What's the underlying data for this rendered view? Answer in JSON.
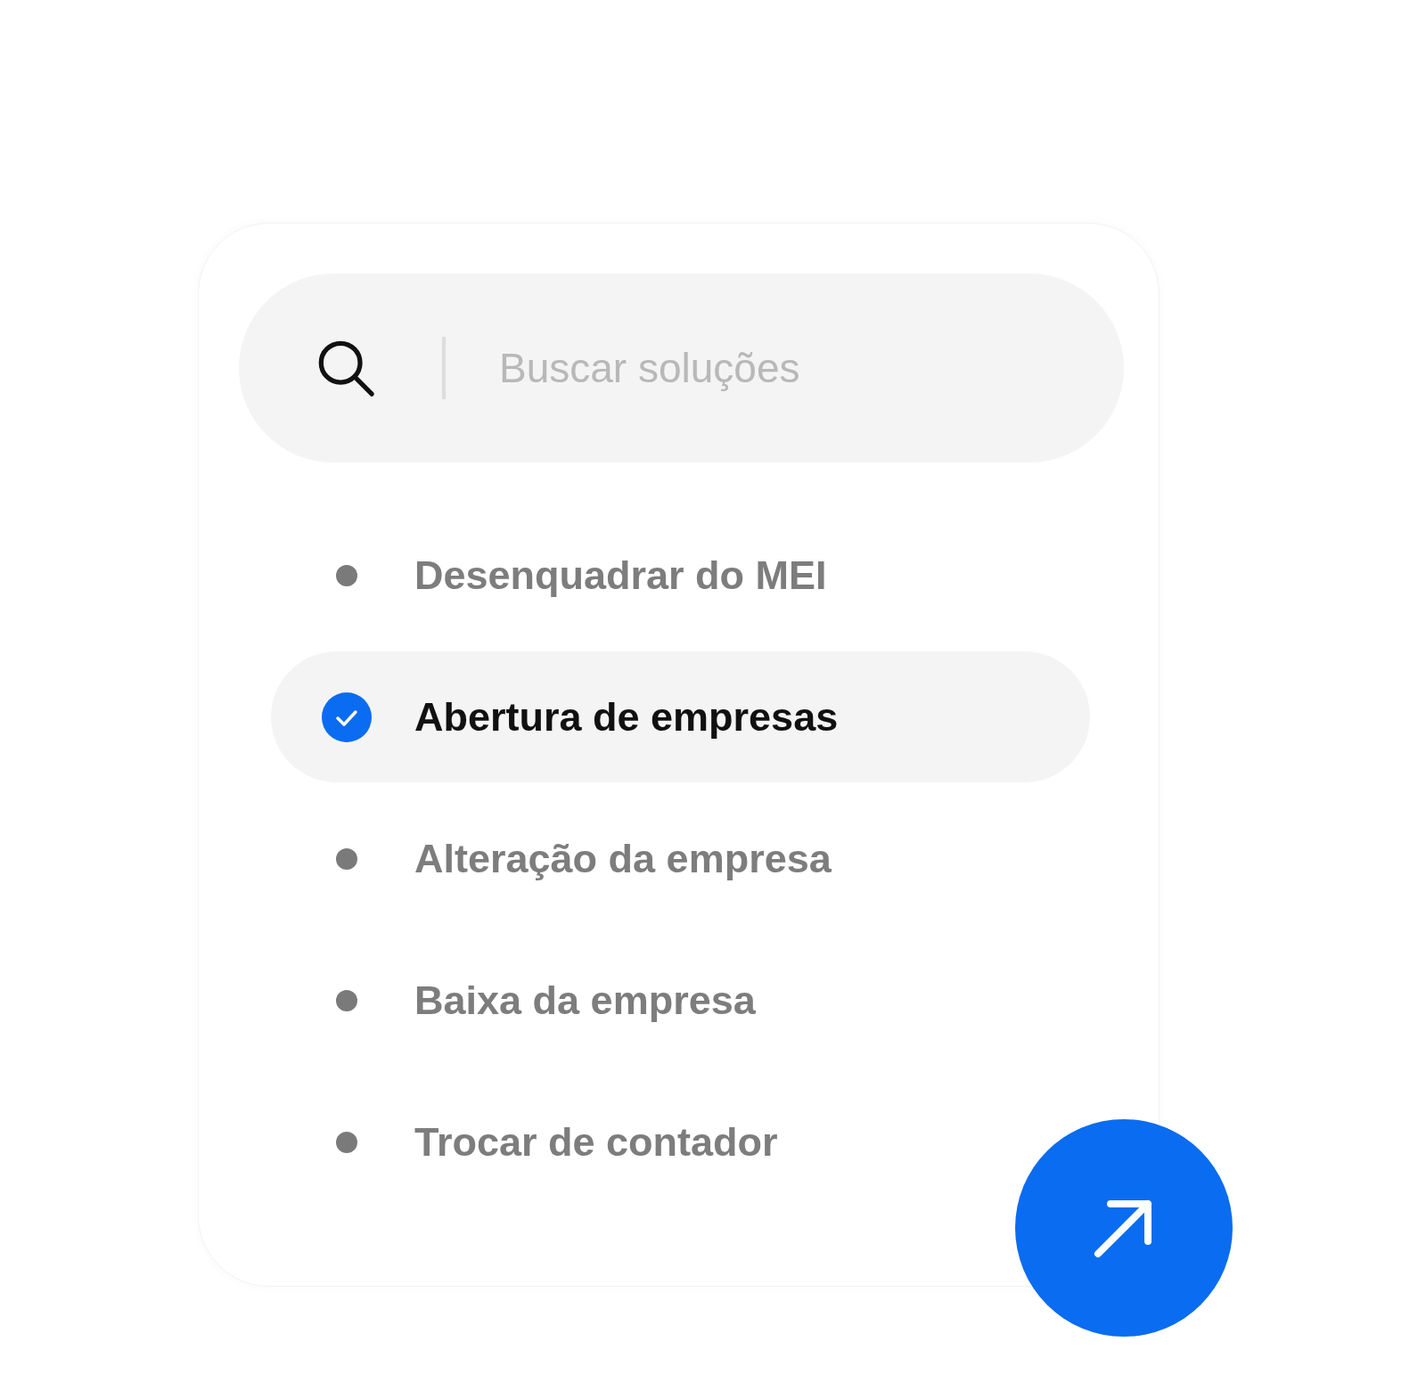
{
  "search": {
    "placeholder": "Buscar soluções"
  },
  "items": [
    {
      "label": "Desenquadrar do MEI",
      "selected": false
    },
    {
      "label": "Abertura de empresas",
      "selected": true
    },
    {
      "label": "Alteração da empresa",
      "selected": false
    },
    {
      "label": "Baixa da empresa",
      "selected": false
    },
    {
      "label": "Trocar de contador",
      "selected": false
    }
  ]
}
